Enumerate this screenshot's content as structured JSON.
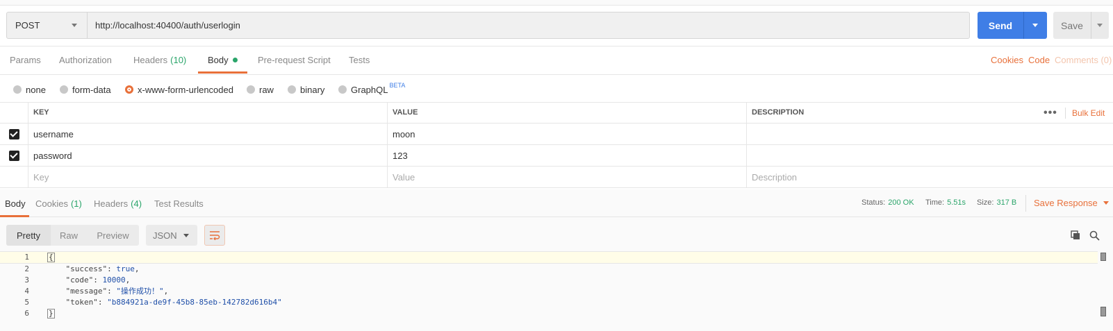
{
  "request": {
    "method": "POST",
    "url": "http://localhost:40400/auth/userlogin",
    "send_label": "Send",
    "save_label": "Save"
  },
  "request_tabs": [
    {
      "label": "Params"
    },
    {
      "label": "Authorization"
    },
    {
      "label": "Headers",
      "count": "(10)"
    },
    {
      "label": "Body"
    },
    {
      "label": "Pre-request Script"
    },
    {
      "label": "Tests"
    }
  ],
  "right_links": {
    "cookies": "Cookies",
    "code": "Code",
    "comments": "Comments (0)"
  },
  "body_types": [
    {
      "label": "none"
    },
    {
      "label": "form-data"
    },
    {
      "label": "x-www-form-urlencoded",
      "selected": true
    },
    {
      "label": "raw"
    },
    {
      "label": "binary"
    },
    {
      "label": "GraphQL",
      "badge": "BETA"
    }
  ],
  "params_table": {
    "headers": [
      "KEY",
      "VALUE",
      "DESCRIPTION"
    ],
    "bulk_edit": "Bulk Edit",
    "more": "•••",
    "rows": [
      {
        "key": "username",
        "value": "moon",
        "description": ""
      },
      {
        "key": "password",
        "value": "123",
        "description": ""
      }
    ],
    "placeholders": {
      "key": "Key",
      "value": "Value",
      "description": "Description"
    }
  },
  "response_tabs": [
    {
      "label": "Body"
    },
    {
      "label": "Cookies",
      "count": "(1)"
    },
    {
      "label": "Headers",
      "count": "(4)"
    },
    {
      "label": "Test Results"
    }
  ],
  "response_status": {
    "status_label": "Status:",
    "status_value": "200 OK",
    "time_label": "Time:",
    "time_value": "5.51s",
    "size_label": "Size:",
    "size_value": "317 B",
    "save_response": "Save Response"
  },
  "view_modes": [
    "Pretty",
    "Raw",
    "Preview"
  ],
  "format": "JSON",
  "code_lines": [
    {
      "n": "1",
      "text": "{"
    },
    {
      "n": "2",
      "key": "\"success\"",
      "val": "true",
      "trail": ","
    },
    {
      "n": "3",
      "key": "\"code\"",
      "val": "10000",
      "trail": ","
    },
    {
      "n": "4",
      "key": "\"message\"",
      "val": "\"操作成功！\"",
      "trail": ","
    },
    {
      "n": "5",
      "key": "\"token\"",
      "val": "\"b884921a-de9f-45b8-85eb-142782d616b4\"",
      "trail": ""
    },
    {
      "n": "6",
      "text": "}"
    }
  ],
  "colors": {
    "accent": "#e8703a",
    "send": "#3f7ee6",
    "success": "#2aa56a"
  }
}
